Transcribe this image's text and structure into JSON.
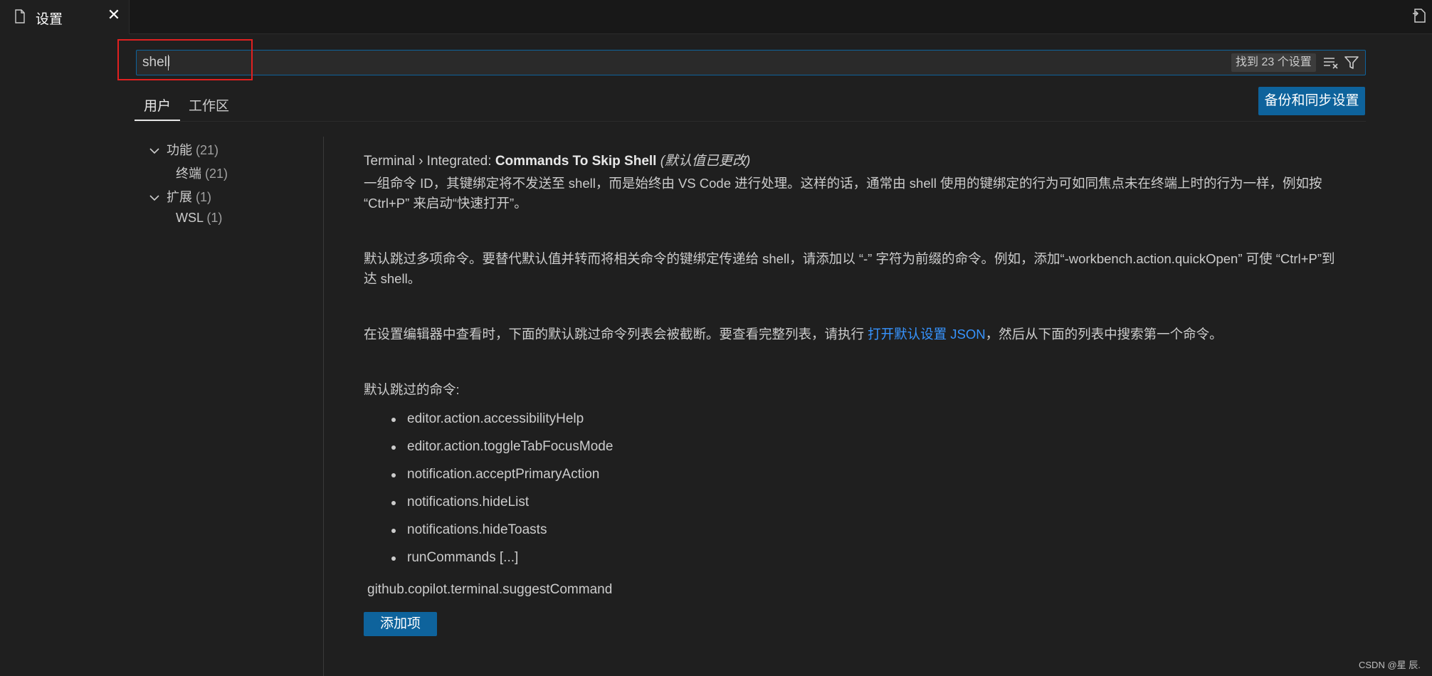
{
  "tab": {
    "title": "设置",
    "close": "✕"
  },
  "search": {
    "value": "shell",
    "result_count": "找到 23 个设置"
  },
  "scopes": {
    "user": "用户",
    "workspace": "工作区"
  },
  "sync_button": "备份和同步设置",
  "toc": {
    "features": {
      "label": "功能",
      "count": "(21)"
    },
    "terminal": {
      "label": "终端",
      "count": "(21)"
    },
    "extensions": {
      "label": "扩展",
      "count": "(1)"
    },
    "wsl": {
      "label": "WSL",
      "count": "(1)"
    }
  },
  "setting": {
    "category": "Terminal › Integrated: ",
    "key": "Commands To Skip Shell",
    "modified": "(默认值已更改)",
    "desc1": "一组命令 ID，其键绑定将不发送至 shell，而是始终由 VS Code 进行处理。这样的话，通常由 shell 使用的键绑定的行为可如同焦点未在终端上时的行为一样，例如按 “Ctrl+P” 来启动“快速打开”。",
    "desc2": "默认跳过多项命令。要替代默认值并转而将相关命令的键绑定传递给 shell，请添加以 “-” 字符为前缀的命令。例如，添加“-workbench.action.quickOpen” 可使 “Ctrl+P”到达 shell。",
    "desc3_pre": "在设置编辑器中查看时，下面的默认跳过命令列表会被截断。要查看完整列表，请执行 ",
    "desc3_link": "打开默认设置 JSON",
    "desc3_post": "，然后从下面的列表中搜索第一个命令。",
    "default_heading": "默认跳过的命令:",
    "defaults": [
      "editor.action.accessibilityHelp",
      "editor.action.toggleTabFocusMode",
      "notification.acceptPrimaryAction",
      "notifications.hideList",
      "notifications.hideToasts",
      "runCommands [...]"
    ],
    "list_value": "github.copilot.terminal.suggestCommand",
    "add_button": "添加项"
  },
  "watermark": "CSDN @星 辰.",
  "colors": {
    "accent": "#0e639c",
    "link": "#3794ff",
    "annotation": "#e02020"
  }
}
